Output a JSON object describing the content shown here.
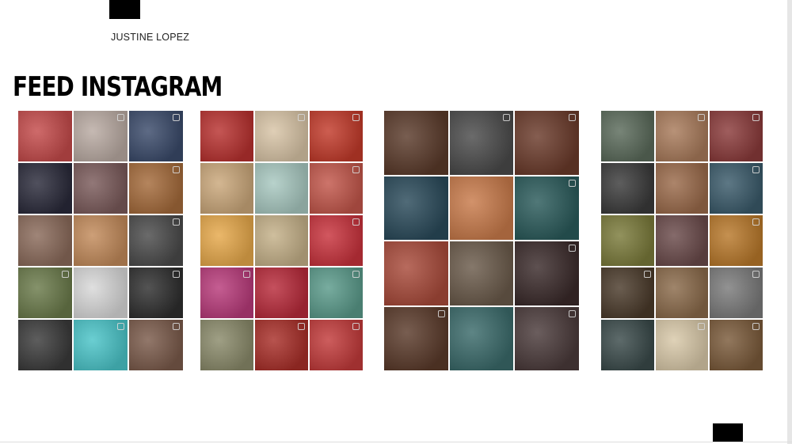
{
  "author": "JUSTINE LOPEZ",
  "title": "FEED INSTAGRAM",
  "feeds": [
    {
      "name": "jewelry-fashion-feed",
      "tiles": [
        "#c44a4a",
        "#b9aaa2",
        "#3a4a6a",
        "#2a2a3a",
        "#7a5a5a",
        "#a46a3a",
        "#8a6a5a",
        "#c28a5a",
        "#4a4a4a",
        "#6a7a4a",
        "#d8d8d8",
        "#2e2e2e",
        "#3a3a3a",
        "#4ac4c8",
        "#7a5a4a"
      ]
    },
    {
      "name": "restaurant-food-feed",
      "tiles": [
        "#b8312f",
        "#d8c4a6",
        "#c23a2a",
        "#caa77a",
        "#a8c8c0",
        "#c2564a",
        "#e6a84a",
        "#c4b088",
        "#c8323c",
        "#b83a7a",
        "#b82a3a",
        "#5a9a8a",
        "#8a8a6a",
        "#a82e28",
        "#c23a3a"
      ]
    },
    {
      "name": "bar-nightlife-feed",
      "tiles": [
        "#5a3a2a",
        "#4a4a4a",
        "#6a3a2a",
        "#2a4a5a",
        "#c87a4a",
        "#2a5a5a",
        "#a84a3a",
        "#6a5a4a",
        "#3a2a2a",
        "#5a3a2a",
        "#3a6a6a",
        "#4a3a3a"
      ]
    },
    {
      "name": "wine-dining-feed",
      "tiles": [
        "#5a6a5a",
        "#a87a5a",
        "#8a3a3a",
        "#3a3a3a",
        "#9a6a4a",
        "#3a5a6a",
        "#7a7a3a",
        "#6a4a4a",
        "#b8782a",
        "#4a3a2a",
        "#8a6a4a",
        "#7a7a7a",
        "#3a4a4a",
        "#d8c8a8",
        "#7a5a3a"
      ]
    }
  ]
}
